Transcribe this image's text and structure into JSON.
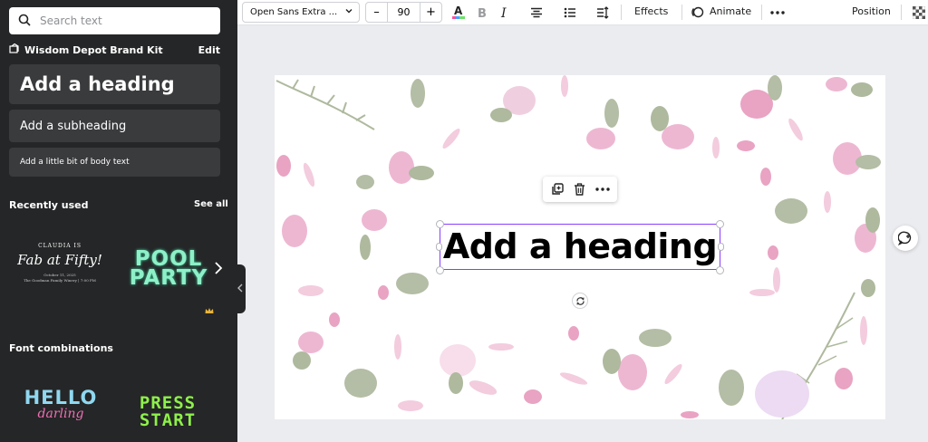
{
  "sidebar": {
    "search_placeholder": "Search text",
    "brand_kit_title": "Wisdom Depot Brand Kit",
    "edit_label": "Edit",
    "heading_card": "Add a heading",
    "subheading_card": "Add a subheading",
    "body_card": "Add a little bit of body text",
    "recently_used_title": "Recently used",
    "see_all_label": "See all",
    "font_combinations_title": "Font combinations",
    "templates": {
      "claudia_top": "CLAUDIA IS",
      "claudia_main": "Fab at Fifty!",
      "claudia_small_1": "October 11, 2025",
      "claudia_small_2": "The Goodman Family Winery | 7:00 PM",
      "pool_line1": "POOL",
      "pool_line2": "PARTY",
      "hello_line1": "HELLO",
      "hello_line2": "darling",
      "press_line1": "PRESS",
      "press_line2": "START"
    }
  },
  "toolbar": {
    "font_name": "Open Sans Extra ...",
    "font_size": "90",
    "minus": "–",
    "plus": "+",
    "effects_label": "Effects",
    "animate_label": "Animate",
    "position_label": "Position",
    "text_color": "#000000"
  },
  "canvas": {
    "heading_text": "Add a heading"
  },
  "colors": {
    "sidebar_bg": "#252627",
    "card_bg": "#3a3b3d",
    "selection": "#8b3dff",
    "petal_pink": "#e9a6c7",
    "leaf_green": "#8c9e7a"
  },
  "icons": [
    "search-icon",
    "brand-kit-icon",
    "chevron-down-icon",
    "bold-icon",
    "italic-icon",
    "align-center-icon",
    "list-icon",
    "line-spacing-icon",
    "animate-icon",
    "more-icon",
    "transparency-icon",
    "duplicate-icon",
    "trash-icon",
    "rotate-icon",
    "comment-add-icon",
    "chevron-right-icon",
    "chevron-left-icon",
    "crown-icon"
  ]
}
